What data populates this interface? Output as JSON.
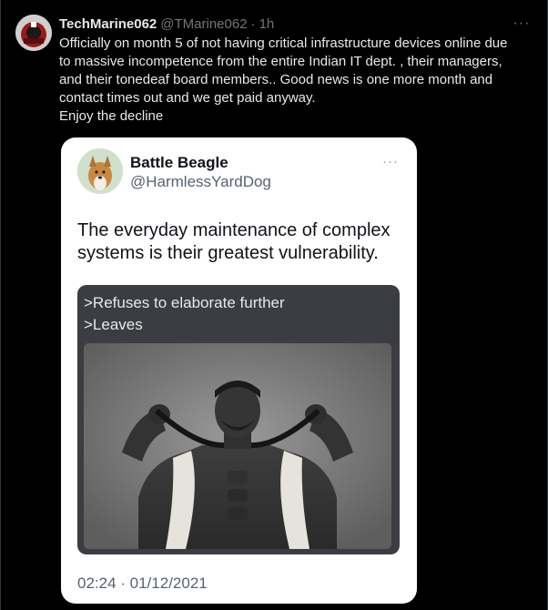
{
  "post": {
    "display_name": "TechMarine062",
    "handle": "@TMarine062",
    "separator": "·",
    "time": "1h",
    "more_glyph": "···",
    "text_lines": [
      "Officially on month 5 of not having critical infrastructure devices online due",
      "to massive incompetence from the entire Indian IT dept. , their managers,",
      "and their tonedeaf board members.. Good news is one more month and",
      "contact times out and we get paid anyway.",
      "Enjoy the decline"
    ]
  },
  "quoted": {
    "display_name": "Battle Beagle",
    "handle": "@HarmlessYardDog",
    "more_glyph": "···",
    "text_lines": [
      "The everyday maintenance of complex",
      "systems is their greatest vulnerability."
    ],
    "meme_lines": [
      ">Refuses to elaborate further",
      ">Leaves"
    ],
    "timestamp": "02:24 · 01/12/2021"
  },
  "icons": {
    "avatar": "user-avatar",
    "quoted_avatar": "dog-avatar",
    "more": "more-options-icon"
  }
}
